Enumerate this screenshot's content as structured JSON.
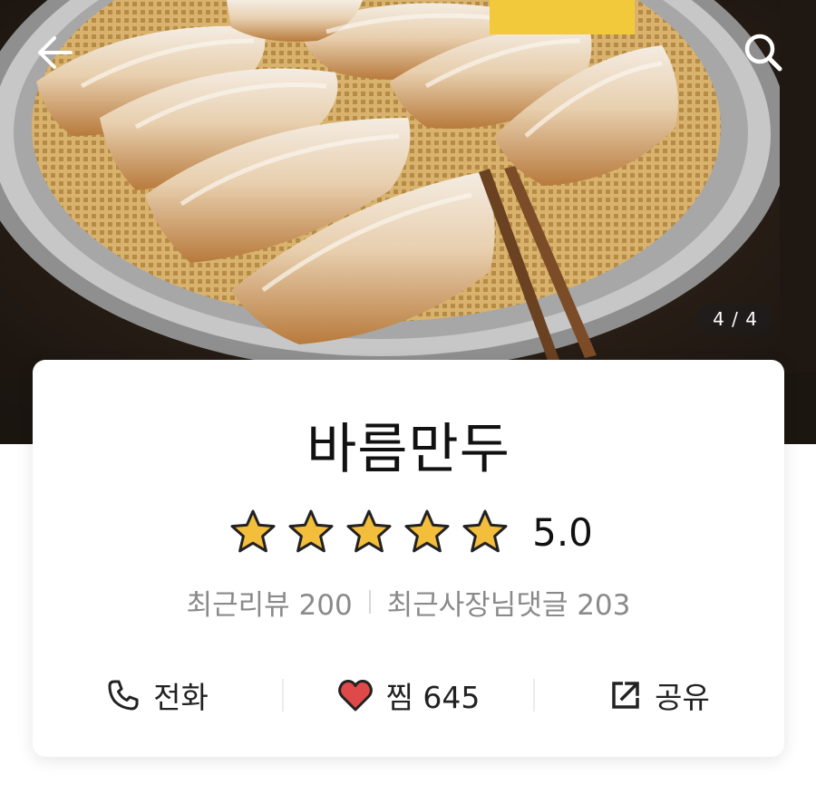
{
  "hero": {
    "page_counter": "4 / 4",
    "back_icon": "arrow-left-icon",
    "search_icon": "search-icon"
  },
  "store": {
    "name": "바름만두",
    "rating_value": "5.0",
    "stars_filled": 5,
    "stars_total": 5,
    "star_color": "#f2be3c"
  },
  "stats": {
    "recent_reviews": "최근리뷰 200",
    "recent_owner_replies": "최근사장님댓글 203"
  },
  "actions": {
    "call_label": "전화",
    "call_icon": "phone-icon",
    "like_label": "찜 645",
    "like_icon": "heart-icon",
    "like_color": "#e0494a",
    "share_label": "공유",
    "share_icon": "share-icon"
  }
}
